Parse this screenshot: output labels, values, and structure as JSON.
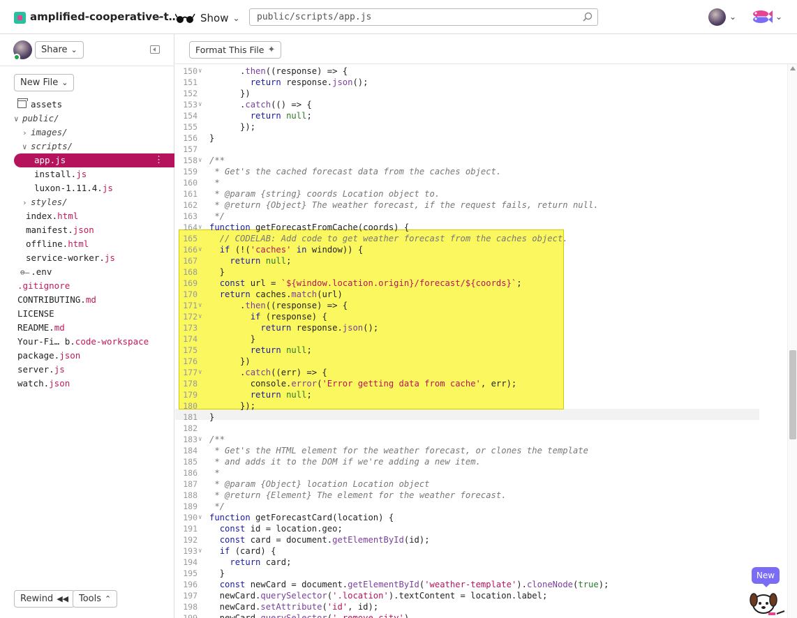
{
  "topbar": {
    "project_name": "amplified-cooperative-t…",
    "show_label": "Show",
    "search_value": "public/scripts/app.js",
    "icons": [
      "glasses-icon",
      "search-icon",
      "chevron-down-icon",
      "fish-logo"
    ]
  },
  "sidebar": {
    "share_label": "Share",
    "new_file_label": "New File",
    "rewind_label": "Rewind",
    "tools_label": "Tools",
    "tree": [
      {
        "name": "assets",
        "ext": "",
        "kind": "assets",
        "indent": 0
      },
      {
        "name": "public/",
        "ext": "",
        "kind": "folder-open",
        "indent": 0
      },
      {
        "name": "images/",
        "ext": "",
        "kind": "folder-closed",
        "indent": 1
      },
      {
        "name": "scripts/",
        "ext": "",
        "kind": "folder-open",
        "indent": 1
      },
      {
        "name": "app.",
        "ext": "js",
        "kind": "file-selected",
        "indent": 2
      },
      {
        "name": "install.",
        "ext": "js",
        "kind": "file",
        "indent": 2
      },
      {
        "name": "luxon-1.11.4.",
        "ext": "js",
        "kind": "file",
        "indent": 2
      },
      {
        "name": "styles/",
        "ext": "",
        "kind": "folder-closed",
        "indent": 1
      },
      {
        "name": "index.",
        "ext": "html",
        "kind": "file",
        "indent": 1
      },
      {
        "name": "manifest.",
        "ext": "json",
        "kind": "file",
        "indent": 1
      },
      {
        "name": "offline.",
        "ext": "html",
        "kind": "file",
        "indent": 1
      },
      {
        "name": "service-worker.",
        "ext": "js",
        "kind": "file",
        "indent": 1
      },
      {
        "name": ".env",
        "ext": "",
        "kind": "env",
        "indent": 1
      },
      {
        "name": ".gitignore",
        "ext": "",
        "kind": "file-colored",
        "indent": 0
      },
      {
        "name": "CONTRIBUTING.",
        "ext": "md",
        "kind": "file",
        "indent": 0
      },
      {
        "name": "LICENSE",
        "ext": "",
        "kind": "file",
        "indent": 0
      },
      {
        "name": "README.",
        "ext": "md",
        "kind": "file",
        "indent": 0
      },
      {
        "name": "Your-Fi… b.",
        "ext": "code-workspace",
        "kind": "file",
        "indent": 0
      },
      {
        "name": "package.",
        "ext": "json",
        "kind": "file",
        "indent": 0
      },
      {
        "name": "server.",
        "ext": "js",
        "kind": "file",
        "indent": 0
      },
      {
        "name": "watch.",
        "ext": "json",
        "kind": "file",
        "indent": 0
      }
    ]
  },
  "editor": {
    "format_label": "Format This File",
    "new_badge": "New",
    "lines": [
      {
        "n": "150",
        "fold": true,
        "code": "      .then((response) => {"
      },
      {
        "n": "151",
        "fold": false,
        "code": "        return response.json();"
      },
      {
        "n": "152",
        "fold": false,
        "code": "      })"
      },
      {
        "n": "153",
        "fold": true,
        "code": "      .catch(() => {"
      },
      {
        "n": "154",
        "fold": false,
        "code": "        return null;"
      },
      {
        "n": "155",
        "fold": false,
        "code": "      });"
      },
      {
        "n": "156",
        "fold": false,
        "code": "}"
      },
      {
        "n": "157",
        "fold": false,
        "code": ""
      },
      {
        "n": "158",
        "fold": true,
        "code": "/**"
      },
      {
        "n": "159",
        "fold": false,
        "code": " * Get's the cached forecast data from the caches object."
      },
      {
        "n": "160",
        "fold": false,
        "code": " *"
      },
      {
        "n": "161",
        "fold": false,
        "code": " * @param {string} coords Location object to."
      },
      {
        "n": "162",
        "fold": false,
        "code": " * @return {Object} The weather forecast, if the request fails, return null."
      },
      {
        "n": "163",
        "fold": false,
        "code": " */"
      },
      {
        "n": "164",
        "fold": true,
        "code": "function getForecastFromCache(coords) {"
      },
      {
        "n": "165",
        "fold": false,
        "code": "  // CODELAB: Add code to get weather forecast from the caches object."
      },
      {
        "n": "166",
        "fold": true,
        "code": "  if (!('caches' in window)) {"
      },
      {
        "n": "167",
        "fold": false,
        "code": "    return null;"
      },
      {
        "n": "168",
        "fold": false,
        "code": "  }"
      },
      {
        "n": "169",
        "fold": false,
        "code": "  const url = `${window.location.origin}/forecast/${coords}`;"
      },
      {
        "n": "170",
        "fold": false,
        "code": "  return caches.match(url)"
      },
      {
        "n": "171",
        "fold": true,
        "code": "      .then((response) => {"
      },
      {
        "n": "172",
        "fold": true,
        "code": "        if (response) {"
      },
      {
        "n": "173",
        "fold": false,
        "code": "          return response.json();"
      },
      {
        "n": "174",
        "fold": false,
        "code": "        }"
      },
      {
        "n": "175",
        "fold": false,
        "code": "        return null;"
      },
      {
        "n": "176",
        "fold": false,
        "code": "      })"
      },
      {
        "n": "177",
        "fold": true,
        "code": "      .catch((err) => {"
      },
      {
        "n": "178",
        "fold": false,
        "code": "        console.error('Error getting data from cache', err);"
      },
      {
        "n": "179",
        "fold": false,
        "code": "        return null;"
      },
      {
        "n": "180",
        "fold": false,
        "code": "      });"
      },
      {
        "n": "181",
        "fold": false,
        "code": "}"
      },
      {
        "n": "182",
        "fold": false,
        "code": ""
      },
      {
        "n": "183",
        "fold": true,
        "code": "/**"
      },
      {
        "n": "184",
        "fold": false,
        "code": " * Get's the HTML element for the weather forecast, or clones the template"
      },
      {
        "n": "185",
        "fold": false,
        "code": " * and adds it to the DOM if we're adding a new item."
      },
      {
        "n": "186",
        "fold": false,
        "code": " *"
      },
      {
        "n": "187",
        "fold": false,
        "code": " * @param {Object} location Location object"
      },
      {
        "n": "188",
        "fold": false,
        "code": " * @return {Element} The element for the weather forecast."
      },
      {
        "n": "189",
        "fold": false,
        "code": " */"
      },
      {
        "n": "190",
        "fold": true,
        "code": "function getForecastCard(location) {"
      },
      {
        "n": "191",
        "fold": false,
        "code": "  const id = location.geo;"
      },
      {
        "n": "192",
        "fold": false,
        "code": "  const card = document.getElementById(id);"
      },
      {
        "n": "193",
        "fold": true,
        "code": "  if (card) {"
      },
      {
        "n": "194",
        "fold": false,
        "code": "    return card;"
      },
      {
        "n": "195",
        "fold": false,
        "code": "  }"
      },
      {
        "n": "196",
        "fold": false,
        "code": "  const newCard = document.getElementById('weather-template').cloneNode(true);"
      },
      {
        "n": "197",
        "fold": false,
        "code": "  newCard.querySelector('.location').textContent = location.label;"
      },
      {
        "n": "198",
        "fold": false,
        "code": "  newCard.setAttribute('id', id);"
      },
      {
        "n": "199",
        "fold": false,
        "code": "  newCard.querySelector('.remove-city')"
      }
    ]
  }
}
